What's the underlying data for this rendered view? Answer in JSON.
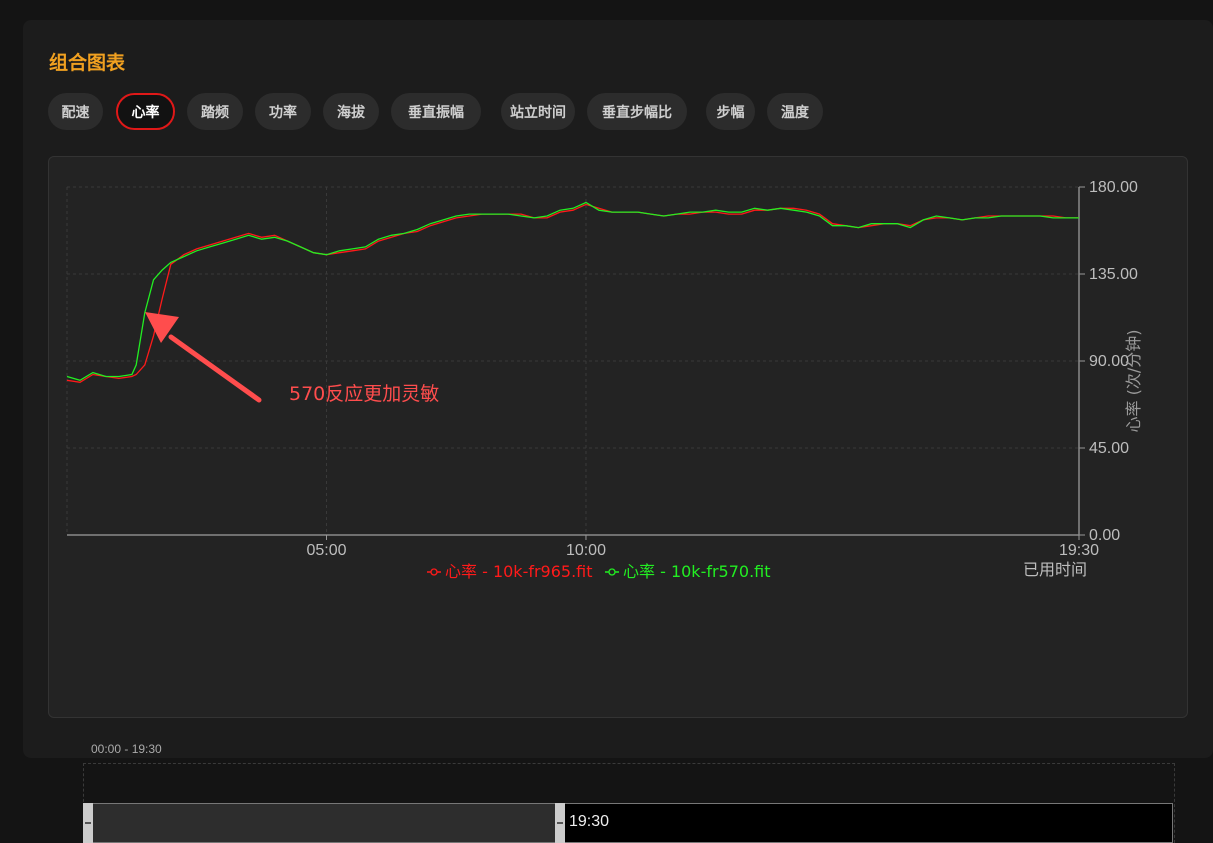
{
  "panel": {
    "title": "组合图表",
    "tabs": [
      "配速",
      "心率",
      "踏频",
      "功率",
      "海拔",
      "垂直振幅",
      "站立时间",
      "垂直步幅比",
      "步幅",
      "温度"
    ],
    "active_tab": "心率"
  },
  "annotation": {
    "text": "570反应更加灵敏",
    "color": "#ff4d4d"
  },
  "zoom": {
    "range_label": "00:00 - 19:30",
    "end_label": "19:30",
    "start_fraction": 0,
    "end_fraction": 0.43
  },
  "colors": {
    "accent": "#f0a020",
    "active_tab_border": "#e01818",
    "series_red": "#ff1a1a",
    "series_green": "#22ee22"
  },
  "chart_data": {
    "type": "line",
    "xlabel": "已用时间",
    "ylabel": "心率 (次/分钟)",
    "ylim": [
      0,
      180
    ],
    "yticks": [
      "0.00",
      "45.00",
      "90.00",
      "135.00",
      "180.00"
    ],
    "xlim": [
      "00:00",
      "19:30"
    ],
    "xticks": [
      "05:00",
      "10:00",
      "19:30"
    ],
    "grid": true,
    "legend_position": "bottom",
    "series": [
      {
        "name": "心率 - 10k-fr965.fit",
        "color": "#ff1a1a",
        "x": [
          "00:00",
          "00:15",
          "00:30",
          "00:45",
          "01:00",
          "01:15",
          "01:20",
          "01:30",
          "01:40",
          "01:50",
          "02:00",
          "02:15",
          "02:30",
          "02:45",
          "03:00",
          "03:15",
          "03:30",
          "03:45",
          "04:00",
          "04:15",
          "04:30",
          "04:45",
          "05:00",
          "05:15",
          "05:30",
          "05:45",
          "06:00",
          "06:15",
          "06:30",
          "06:45",
          "07:00",
          "07:15",
          "07:30",
          "07:45",
          "08:00",
          "08:15",
          "08:30",
          "08:45",
          "09:00",
          "09:15",
          "09:30",
          "09:45",
          "10:00",
          "10:15",
          "10:30",
          "10:45",
          "11:00",
          "11:15",
          "11:30",
          "11:45",
          "12:00",
          "12:15",
          "12:30",
          "12:45",
          "13:00",
          "13:15",
          "13:30",
          "13:45",
          "14:00",
          "14:15",
          "14:30",
          "14:45",
          "15:00",
          "15:15",
          "15:30",
          "15:45",
          "16:00",
          "16:15",
          "16:30",
          "16:45",
          "17:00",
          "17:15",
          "17:30",
          "17:45",
          "18:00",
          "18:15",
          "18:30",
          "18:45",
          "19:00",
          "19:15",
          "19:30"
        ],
        "values": [
          80,
          79,
          83,
          82,
          81,
          82,
          83,
          88,
          103,
          122,
          140,
          145,
          148,
          150,
          152,
          154,
          156,
          154,
          155,
          152,
          149,
          146,
          145,
          146,
          147,
          148,
          152,
          154,
          156,
          157,
          160,
          162,
          164,
          165,
          166,
          166,
          166,
          166,
          164,
          164,
          167,
          168,
          171,
          169,
          167,
          167,
          167,
          166,
          165,
          166,
          166,
          167,
          167,
          166,
          166,
          168,
          168,
          169,
          169,
          168,
          166,
          161,
          160,
          159,
          160,
          161,
          161,
          160,
          163,
          164,
          164,
          163,
          164,
          165,
          165,
          165,
          165,
          165,
          165,
          164,
          164
        ]
      },
      {
        "name": "心率 - 10k-fr570.fit",
        "color": "#22ee22",
        "x": [
          "00:00",
          "00:15",
          "00:30",
          "00:45",
          "01:00",
          "01:15",
          "01:20",
          "01:30",
          "01:40",
          "01:50",
          "02:00",
          "02:15",
          "02:30",
          "02:45",
          "03:00",
          "03:15",
          "03:30",
          "03:45",
          "04:00",
          "04:15",
          "04:30",
          "04:45",
          "05:00",
          "05:15",
          "05:30",
          "05:45",
          "06:00",
          "06:15",
          "06:30",
          "06:45",
          "07:00",
          "07:15",
          "07:30",
          "07:45",
          "08:00",
          "08:15",
          "08:30",
          "08:45",
          "09:00",
          "09:15",
          "09:30",
          "09:45",
          "10:00",
          "10:15",
          "10:30",
          "10:45",
          "11:00",
          "11:15",
          "11:30",
          "11:45",
          "12:00",
          "12:15",
          "12:30",
          "12:45",
          "13:00",
          "13:15",
          "13:30",
          "13:45",
          "14:00",
          "14:15",
          "14:30",
          "14:45",
          "15:00",
          "15:15",
          "15:30",
          "15:45",
          "16:00",
          "16:15",
          "16:30",
          "16:45",
          "17:00",
          "17:15",
          "17:30",
          "17:45",
          "18:00",
          "18:15",
          "18:30",
          "18:45",
          "19:00",
          "19:15",
          "19:30"
        ],
        "values": [
          82,
          80,
          84,
          82,
          82,
          83,
          88,
          115,
          132,
          137,
          141,
          144,
          147,
          149,
          151,
          153,
          155,
          153,
          154,
          152,
          149,
          146,
          145,
          147,
          148,
          149,
          153,
          155,
          156,
          158,
          161,
          163,
          165,
          166,
          166,
          166,
          166,
          165,
          164,
          165,
          168,
          169,
          172,
          168,
          167,
          167,
          167,
          166,
          165,
          166,
          167,
          167,
          168,
          167,
          167,
          169,
          168,
          169,
          168,
          167,
          165,
          160,
          160,
          159,
          161,
          161,
          161,
          159,
          163,
          165,
          164,
          163,
          164,
          164,
          165,
          165,
          165,
          165,
          164,
          164,
          164
        ]
      }
    ]
  }
}
